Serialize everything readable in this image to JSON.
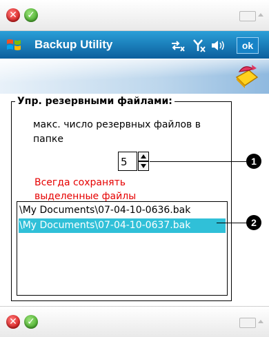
{
  "top_bar": {
    "close_glyph": "✕",
    "ok_glyph": "✓",
    "keyboard_icon": "keyboard-icon"
  },
  "title_bar": {
    "title": "Backup Utility",
    "ok_label": "ok"
  },
  "group": {
    "title": "Упр. резервными файлами:",
    "max_files_label": "макс. число резервных файлов в папке",
    "max_files_value": "5",
    "always_save_label": "Всегда сохранять выделенные файлы"
  },
  "file_list": {
    "items": [
      "\\My Documents\\07-04-10-0636.bak",
      "\\My Documents\\07-04-10-0637.bak"
    ],
    "selected_index": 1
  },
  "callouts": [
    "1",
    "2"
  ],
  "bottom_bar": {
    "close_glyph": "✕",
    "ok_glyph": "✓"
  },
  "colors": {
    "title_bar": "#0c5f9d",
    "selection": "#30c0d8",
    "red_text": "#e60000"
  }
}
